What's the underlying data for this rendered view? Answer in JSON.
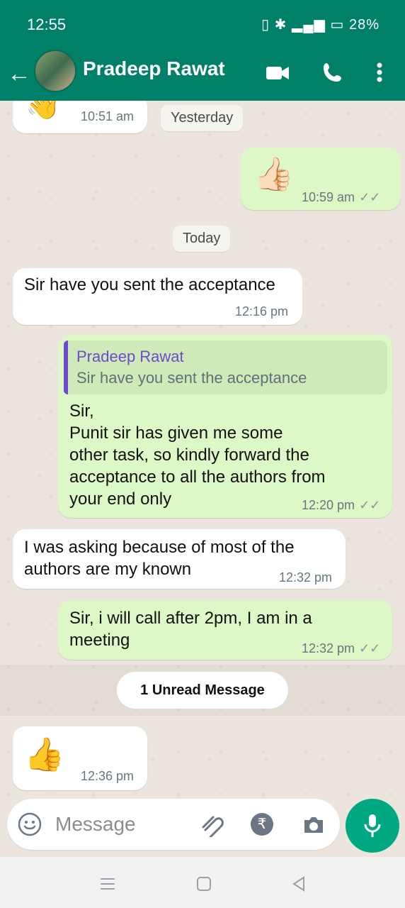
{
  "status": {
    "time": "12:55",
    "battery": "28%"
  },
  "chat": {
    "contact": "Pradeep Rawat"
  },
  "messages": [
    {
      "kind": "in",
      "text": "",
      "time": "10:51 am"
    },
    {
      "kind": "date",
      "text": "Yesterday"
    },
    {
      "kind": "out",
      "text": "",
      "time": "10:59 am"
    },
    {
      "kind": "date",
      "text": "Today"
    },
    {
      "kind": "in",
      "text": "Sir have you sent the acceptance",
      "time": "12:16 pm"
    },
    {
      "kind": "out",
      "reply_to": {
        "name": "Pradeep Rawat",
        "text": "Sir have you sent the acceptance"
      },
      "text": "Sir,\nPunit sir has given me some\nother task, so kindly forward the\nacceptance to all the authors from\nyour end only",
      "time": "12:20 pm"
    },
    {
      "kind": "in",
      "text": "I was asking because of most of the\nauthors are my known",
      "time": "12:32 pm"
    },
    {
      "kind": "out",
      "text": "Sir, i will call after 2pm, I am in a\nmeeting",
      "time": "12:32 pm"
    },
    {
      "kind": "unread",
      "text": "1 Unread Message"
    },
    {
      "kind": "in",
      "text": "",
      "time": "12:36 pm"
    }
  ],
  "composer": {
    "placeholder": "Message"
  },
  "emojis": {
    "wave": "👋",
    "thumbs_light": "👍🏻",
    "thumbs": "👍"
  },
  "colors": {
    "header": "#008069",
    "outgoing": "#dcf8c6",
    "incoming": "#ffffff",
    "mic": "#00a884",
    "reply_accent": "#6d4bd0"
  }
}
